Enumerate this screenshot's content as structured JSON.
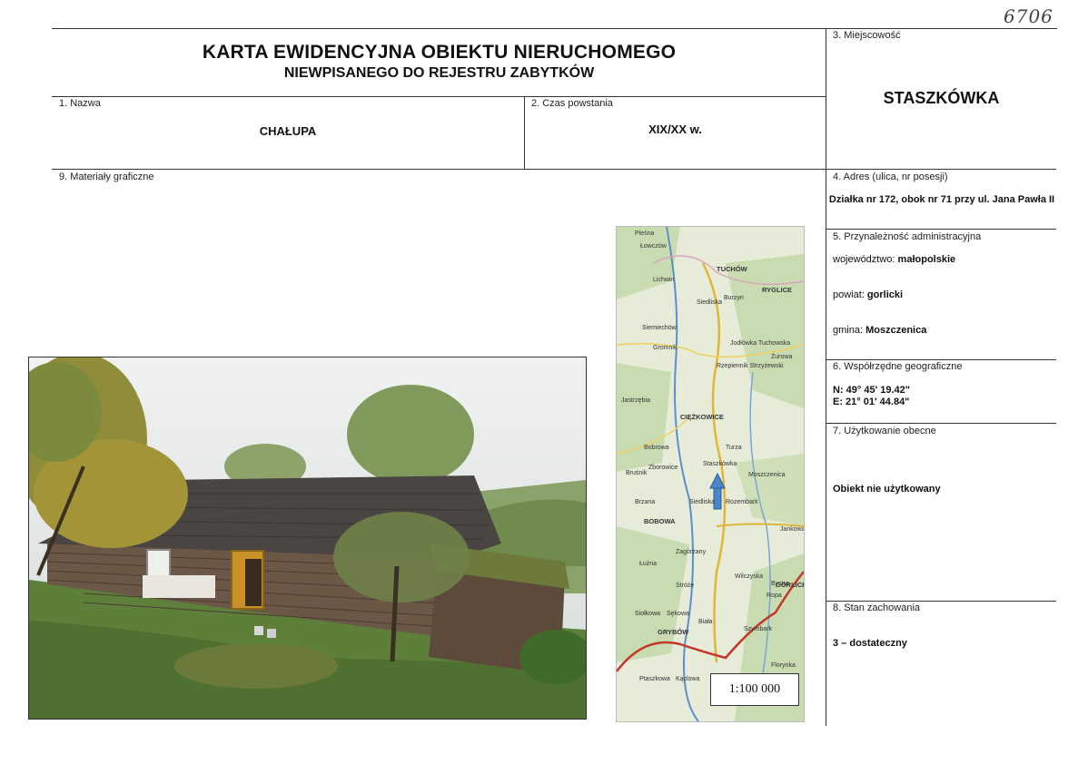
{
  "doc_number": "6706",
  "header": {
    "title": "KARTA EWIDENCYJNA OBIEKTU NIERUCHOMEGO",
    "subtitle": "NIEWPISANEGO DO REJESTRU ZABYTKÓW"
  },
  "fields": {
    "name": {
      "label": "1. Nazwa",
      "value": "CHAŁUPA"
    },
    "date": {
      "label": "2. Czas powstania",
      "value": "XIX/XX w."
    },
    "locality": {
      "label": "3. Miejscowość",
      "value": "STASZKÓWKA"
    },
    "address": {
      "label": "4. Adres (ulica, nr posesji)",
      "value": "Działka nr 172, obok nr 71 przy ul. Jana Pawła II"
    },
    "admin": {
      "label": "5. Przynależność administracyjna",
      "voivodeship_label": "województwo:",
      "voivodeship": "małopolskie",
      "county_label": "powiat:",
      "county": "gorlicki",
      "commune_label": "gmina:",
      "commune": "Moszczenica"
    },
    "coords": {
      "label": "6. Współrzędne geograficzne",
      "lat": "N: 49° 45' 19.42\"",
      "lon": "E: 21° 01' 44.84\""
    },
    "usage": {
      "label": "7. Użytkowanie obecne",
      "value": "Obiekt nie użytkowany"
    },
    "condition": {
      "label": "8. Stan zachowania",
      "value": "3 – dostateczny"
    },
    "graphics": {
      "label": "9. Materiały graficzne"
    }
  },
  "map": {
    "scale": "1:100 000",
    "places": [
      "Pleśna",
      "Łowczów",
      "TUCHÓW",
      "RYGLICE",
      "Lichwin",
      "Siedliska",
      "Burzyn",
      "Siemiechów",
      "Gromnik",
      "Jodłówka Tuchowska",
      "Rzepiennik Strzyżewski",
      "Żurowa",
      "Jastrzębia",
      "CIĘŻKOWICE",
      "Bobrowa",
      "Zborowice",
      "Turza",
      "Bruśnik",
      "Staszkówka",
      "Moszczenica",
      "Rozembark",
      "Siedliska",
      "Brzana",
      "BOBOWA",
      "Jankowa",
      "Zagórzany",
      "Łużna",
      "Wilczyska",
      "Bystra",
      "GORLICE",
      "Stróże",
      "Ropa",
      "Siołkowa",
      "Sękowa",
      "GRYBÓW",
      "Biała",
      "Szymbark",
      "Florynka",
      "Ptaszkowa",
      "Kąclowa"
    ]
  }
}
